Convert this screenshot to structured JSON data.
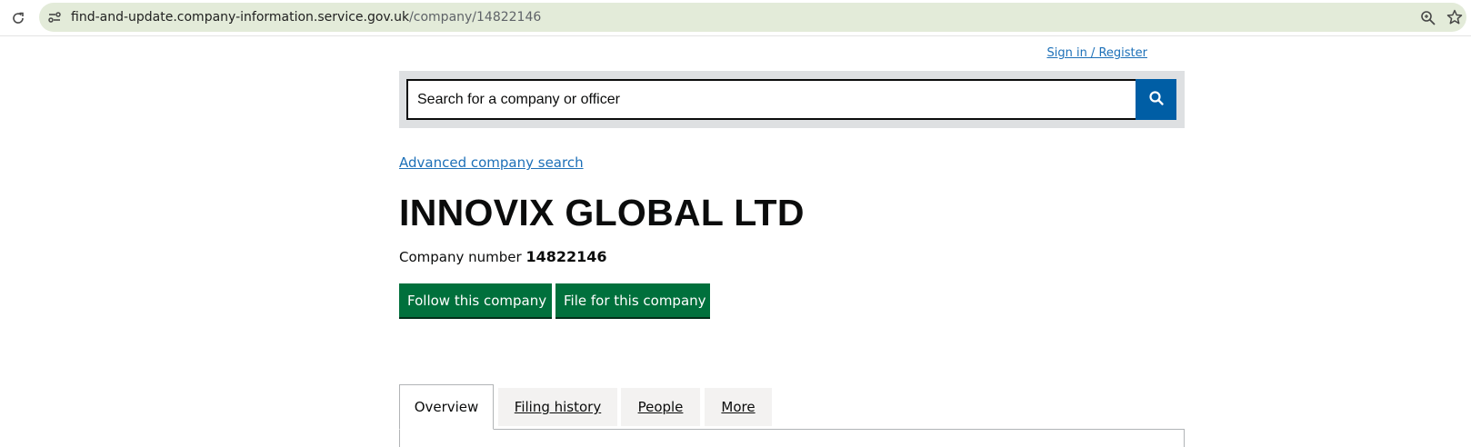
{
  "browser": {
    "url_host": "find-and-update.company-information.service.gov.uk",
    "url_path": "/company/14822146",
    "icons": [
      "reload-icon",
      "site-info-icon",
      "zoom-icon",
      "star-icon"
    ]
  },
  "header": {
    "signin_label": "Sign in / Register"
  },
  "search": {
    "placeholder": "Search for a company or officer",
    "button_icon": "search-icon"
  },
  "advanced_search_label": "Advanced company search",
  "company": {
    "name": "INNOVIX GLOBAL LTD",
    "number_label": "Company number",
    "number": "14822146"
  },
  "actions": {
    "follow_label": "Follow this company",
    "file_label": "File for this company"
  },
  "tabs": [
    {
      "label": "Overview",
      "active": true
    },
    {
      "label": "Filing history",
      "active": false
    },
    {
      "label": "People",
      "active": false
    },
    {
      "label": "More",
      "active": false
    }
  ],
  "colors": {
    "link": "#1d70b8",
    "search_button": "#005ea5",
    "action_button": "#00703c",
    "omnibox": "#e3ebd9"
  }
}
